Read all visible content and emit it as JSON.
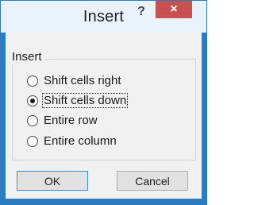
{
  "dialog": {
    "title": "Insert",
    "help_glyph": "?",
    "close_glyph": "×"
  },
  "group": {
    "label": "Insert",
    "options": [
      {
        "label": "Shift cells right",
        "checked": false
      },
      {
        "label": "Shift cells down",
        "checked": true
      },
      {
        "label": "Entire row",
        "checked": false
      },
      {
        "label": "Entire column",
        "checked": false
      }
    ]
  },
  "buttons": {
    "ok": "OK",
    "cancel": "Cancel"
  },
  "colors": {
    "frame": "#2b7bbf",
    "titlebar": "#eaf2fb",
    "close_button": "#c75050",
    "client": "#f0f0f0"
  },
  "icons": [
    "help-icon",
    "close-icon"
  ]
}
